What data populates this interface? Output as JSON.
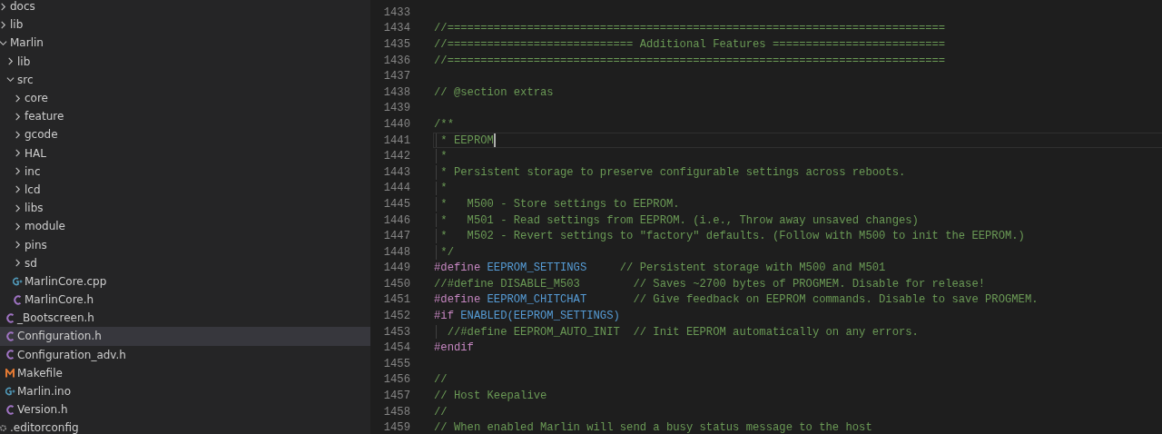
{
  "explorer": {
    "items": [
      {
        "kind": "folder",
        "label": "docs",
        "expanded": false,
        "selected": false
      },
      {
        "kind": "folder",
        "label": "lib",
        "expanded": false,
        "selected": false
      },
      {
        "kind": "folder",
        "label": "Marlin",
        "expanded": true,
        "selected": false,
        "children": [
          {
            "kind": "folder",
            "label": "lib",
            "expanded": false,
            "selected": false
          },
          {
            "kind": "folder",
            "label": "src",
            "expanded": true,
            "selected": false,
            "children": [
              {
                "kind": "folder",
                "label": "core",
                "expanded": false,
                "selected": false
              },
              {
                "kind": "folder",
                "label": "feature",
                "expanded": false,
                "selected": false
              },
              {
                "kind": "folder",
                "label": "gcode",
                "expanded": false,
                "selected": false
              },
              {
                "kind": "folder",
                "label": "HAL",
                "expanded": false,
                "selected": false
              },
              {
                "kind": "folder",
                "label": "inc",
                "expanded": false,
                "selected": false
              },
              {
                "kind": "folder",
                "label": "lcd",
                "expanded": false,
                "selected": false
              },
              {
                "kind": "folder",
                "label": "libs",
                "expanded": false,
                "selected": false
              },
              {
                "kind": "folder",
                "label": "module",
                "expanded": false,
                "selected": false
              },
              {
                "kind": "folder",
                "label": "pins",
                "expanded": false,
                "selected": false
              },
              {
                "kind": "folder",
                "label": "sd",
                "expanded": false,
                "selected": false
              },
              {
                "kind": "cpp",
                "label": "MarlinCore.cpp",
                "selected": false
              },
              {
                "kind": "c",
                "label": "MarlinCore.h",
                "selected": false
              }
            ]
          },
          {
            "kind": "c",
            "label": "_Bootscreen.h",
            "selected": false
          },
          {
            "kind": "c",
            "label": "Configuration.h",
            "selected": true
          },
          {
            "kind": "c",
            "label": "Configuration_adv.h",
            "selected": false
          },
          {
            "kind": "make",
            "label": "Makefile",
            "selected": false
          },
          {
            "kind": "cpp",
            "label": "Marlin.ino",
            "selected": false
          },
          {
            "kind": "c",
            "label": "Version.h",
            "selected": false
          }
        ]
      },
      {
        "kind": "config",
        "label": ".editorconfig",
        "selected": false
      }
    ]
  },
  "editor": {
    "lines": [
      {
        "number": "1433",
        "current": false,
        "guide": false
      },
      {
        "number": "1434",
        "current": false,
        "guide": false,
        "tokens": [
          {
            "kind": "comment",
            "text": "//==========================================================================="
          }
        ]
      },
      {
        "number": "1435",
        "current": false,
        "guide": false,
        "tokens": [
          {
            "kind": "comment",
            "text": "//============================ Additional Features =========================="
          }
        ]
      },
      {
        "number": "1436",
        "current": false,
        "guide": false,
        "tokens": [
          {
            "kind": "comment",
            "text": "//==========================================================================="
          }
        ]
      },
      {
        "number": "1437",
        "current": false,
        "guide": false
      },
      {
        "number": "1438",
        "current": false,
        "guide": false,
        "tokens": [
          {
            "kind": "comment",
            "text": "// @section extras"
          }
        ]
      },
      {
        "number": "1439",
        "current": false,
        "guide": false
      },
      {
        "number": "1440",
        "current": false,
        "guide": false,
        "tokens": [
          {
            "kind": "comment",
            "text": "/**"
          }
        ]
      },
      {
        "number": "1441",
        "current": true,
        "guide": true,
        "tokens": [
          {
            "kind": "comment",
            "text": " * EEPROM"
          }
        ]
      },
      {
        "number": "1442",
        "current": false,
        "guide": true,
        "tokens": [
          {
            "kind": "comment",
            "text": " *"
          }
        ]
      },
      {
        "number": "1443",
        "current": false,
        "guide": true,
        "tokens": [
          {
            "kind": "comment",
            "text": " * Persistent storage to preserve configurable settings across reboots."
          }
        ]
      },
      {
        "number": "1444",
        "current": false,
        "guide": true,
        "tokens": [
          {
            "kind": "comment",
            "text": " *"
          }
        ]
      },
      {
        "number": "1445",
        "current": false,
        "guide": true,
        "tokens": [
          {
            "kind": "comment",
            "text": " *   M500 - Store settings to EEPROM."
          }
        ]
      },
      {
        "number": "1446",
        "current": false,
        "guide": true,
        "tokens": [
          {
            "kind": "comment",
            "text": " *   M501 - Read settings from EEPROM. (i.e., Throw away unsaved changes)"
          }
        ]
      },
      {
        "number": "1447",
        "current": false,
        "guide": true,
        "tokens": [
          {
            "kind": "comment",
            "text": " *   M502 - Revert settings to \"factory\" defaults. (Follow with M500 to init the EEPROM.)"
          }
        ]
      },
      {
        "number": "1448",
        "current": false,
        "guide": true,
        "tokens": [
          {
            "kind": "comment",
            "text": " */"
          }
        ]
      },
      {
        "number": "1449",
        "current": false,
        "guide": false,
        "tokens": [
          {
            "kind": "directive",
            "text": "#define"
          },
          {
            "kind": "macro",
            "text": " EEPROM_SETTINGS"
          },
          {
            "kind": "comment",
            "text": "     // Persistent storage with M500 and M501"
          }
        ]
      },
      {
        "number": "1450",
        "current": false,
        "guide": false,
        "tokens": [
          {
            "kind": "comment",
            "text": "//#define DISABLE_M503        // Saves ~2700 bytes of PROGMEM. Disable for release!"
          }
        ]
      },
      {
        "number": "1451",
        "current": false,
        "guide": false,
        "tokens": [
          {
            "kind": "directive",
            "text": "#define"
          },
          {
            "kind": "macro",
            "text": " EEPROM_CHITCHAT"
          },
          {
            "kind": "comment",
            "text": "       // Give feedback on EEPROM commands. Disable to save PROGMEM."
          }
        ]
      },
      {
        "number": "1452",
        "current": false,
        "guide": false,
        "tokens": [
          {
            "kind": "directive",
            "text": "#if"
          },
          {
            "kind": "macro",
            "text": " ENABLED(EEPROM_SETTINGS)"
          }
        ]
      },
      {
        "number": "1453",
        "current": false,
        "guide": true,
        "tokens": [
          {
            "kind": "comment",
            "text": "  //#define EEPROM_AUTO_INIT  // Init EEPROM automatically on any errors."
          }
        ]
      },
      {
        "number": "1454",
        "current": false,
        "guide": false,
        "tokens": [
          {
            "kind": "directive",
            "text": "#endif"
          }
        ]
      },
      {
        "number": "1455",
        "current": false,
        "guide": false
      },
      {
        "number": "1456",
        "current": false,
        "guide": false,
        "tokens": [
          {
            "kind": "comment",
            "text": "//"
          }
        ]
      },
      {
        "number": "1457",
        "current": false,
        "guide": false,
        "tokens": [
          {
            "kind": "comment",
            "text": "// Host Keepalive"
          }
        ]
      },
      {
        "number": "1458",
        "current": false,
        "guide": false,
        "tokens": [
          {
            "kind": "comment",
            "text": "//"
          }
        ]
      },
      {
        "number": "1459",
        "current": false,
        "guide": false,
        "tokens": [
          {
            "kind": "comment",
            "text": "// When enabled Marlin will send a busy status message to the host"
          }
        ]
      }
    ]
  }
}
